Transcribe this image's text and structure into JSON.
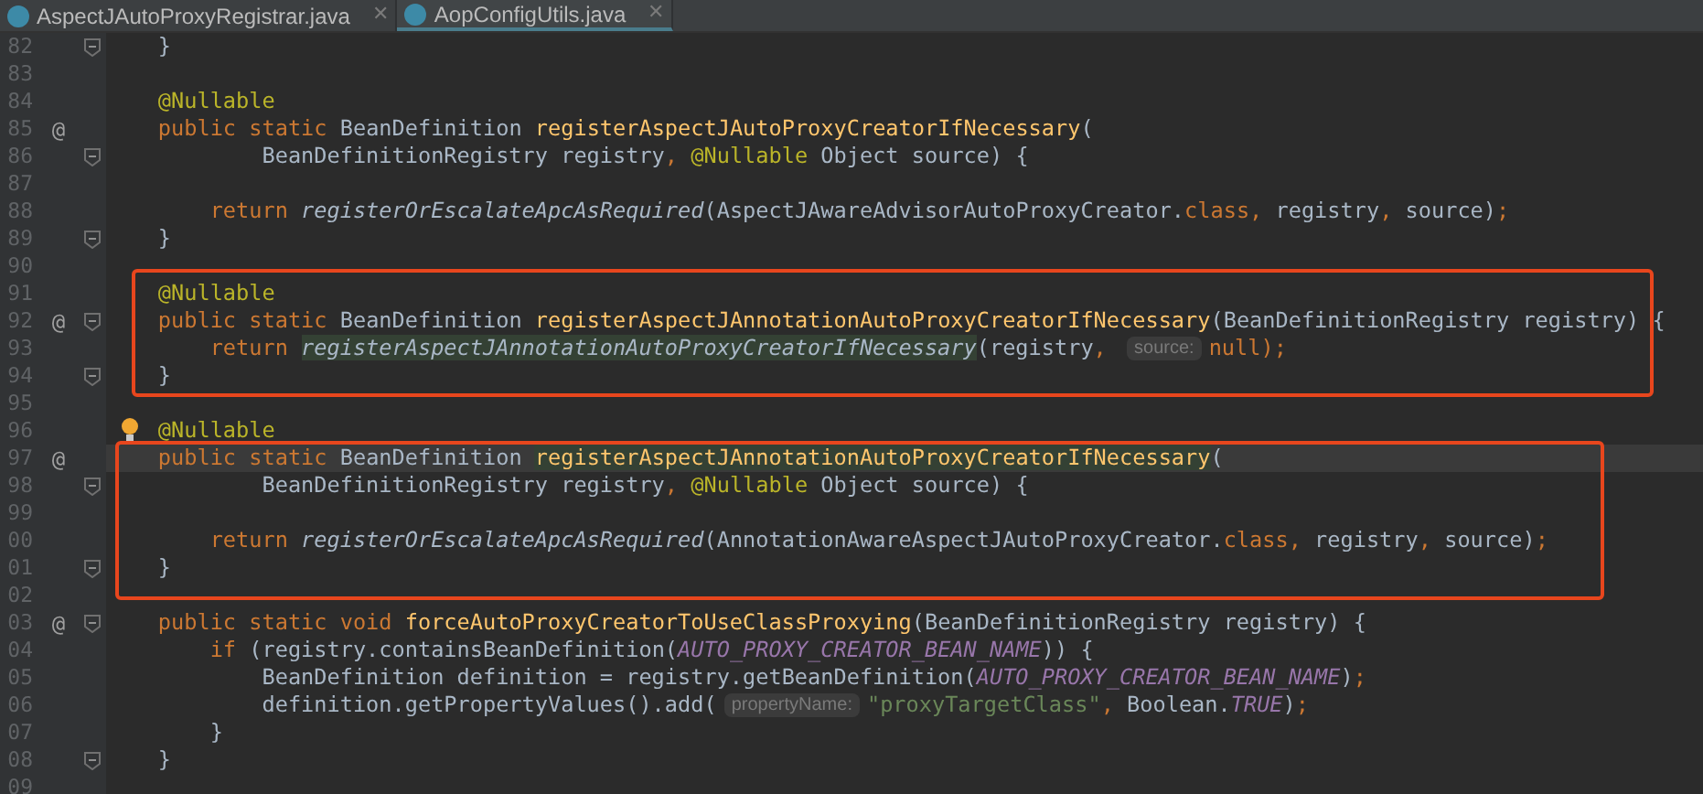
{
  "tabs": [
    {
      "label": "AspectJAutoProxyRegistrar.java",
      "selected": false,
      "close": "✕"
    },
    {
      "label": "AopConfigUtils.java",
      "selected": true,
      "close": "✕"
    }
  ],
  "lines": [
    {
      "number": "82",
      "fold": true,
      "tokens": [
        {
          "kind": "plain",
          "text": "    }"
        }
      ]
    },
    {
      "number": "83"
    },
    {
      "number": "84",
      "tokens": [
        {
          "kind": "annotation",
          "text": "    @Nullable"
        }
      ]
    },
    {
      "number": "85",
      "gutter_marker": "@",
      "tokens": [
        {
          "kind": "keyword",
          "text": "    public static "
        },
        {
          "kind": "plain",
          "text": "BeanDefinition "
        },
        {
          "kind": "method",
          "text": "registerAspectJAutoProxyCreatorIfNecessary"
        },
        {
          "kind": "plain",
          "text": "("
        }
      ]
    },
    {
      "number": "86",
      "fold": true,
      "tokens": [
        {
          "kind": "plain",
          "text": "            BeanDefinitionRegistry registry"
        },
        {
          "kind": "keyword",
          "text": ", "
        },
        {
          "kind": "annotation",
          "text": "@Nullable"
        },
        {
          "kind": "plain",
          "text": " Object source) {"
        }
      ]
    },
    {
      "number": "87"
    },
    {
      "number": "88",
      "tokens": [
        {
          "kind": "keyword",
          "text": "        return "
        },
        {
          "kind": "call",
          "text": "registerOrEscalateApcAsRequired"
        },
        {
          "kind": "plain",
          "text": "(AspectJAwareAdvisorAutoProxyCreator."
        },
        {
          "kind": "keyword",
          "text": "class, "
        },
        {
          "kind": "plain",
          "text": "registry"
        },
        {
          "kind": "keyword",
          "text": ", "
        },
        {
          "kind": "plain",
          "text": "source)"
        },
        {
          "kind": "keyword",
          "text": ";"
        }
      ]
    },
    {
      "number": "89",
      "fold": true,
      "tokens": [
        {
          "kind": "plain",
          "text": "    }"
        }
      ]
    },
    {
      "number": "90"
    },
    {
      "number": "91",
      "tokens": [
        {
          "kind": "annotation",
          "text": "    @Nullable"
        }
      ]
    },
    {
      "number": "92",
      "gutter_marker": "@",
      "fold": true,
      "tokens": [
        {
          "kind": "keyword",
          "text": "    public static "
        },
        {
          "kind": "plain",
          "text": "BeanDefinition "
        },
        {
          "kind": "method",
          "text": "registerAspectJAnnotationAutoProxyCreatorIfNecessary"
        },
        {
          "kind": "plain",
          "text": "(BeanDefinitionRegistry registry) {"
        }
      ]
    },
    {
      "number": "93",
      "tokens": [
        {
          "kind": "keyword",
          "text": "        return "
        },
        {
          "kind": "call-highlighted",
          "text": "registerAspectJAnnotationAutoProxyCreatorIfNecessary"
        },
        {
          "kind": "plain",
          "text": "(registry"
        },
        {
          "kind": "keyword",
          "text": ", "
        },
        {
          "kind": "hint",
          "text": "source:"
        },
        {
          "kind": "keyword",
          "text": "null);"
        }
      ]
    },
    {
      "number": "94",
      "fold": true,
      "tokens": [
        {
          "kind": "plain",
          "text": "    }"
        }
      ]
    },
    {
      "number": "95"
    },
    {
      "number": "96",
      "bulb": true,
      "tokens": [
        {
          "kind": "annotation",
          "text": "    @Nullable"
        }
      ]
    },
    {
      "number": "97",
      "gutter_marker": "@",
      "current": true,
      "tokens": [
        {
          "kind": "keyword",
          "text": "    public static "
        },
        {
          "kind": "plain",
          "text": "BeanDefinition "
        },
        {
          "kind": "method-highlighted",
          "text": "registerAspectJAnnotationAutoProxyCreatorIfNecessary"
        },
        {
          "kind": "plain",
          "text": "("
        }
      ]
    },
    {
      "number": "98",
      "fold": true,
      "tokens": [
        {
          "kind": "plain",
          "text": "            BeanDefinitionRegistry registry"
        },
        {
          "kind": "keyword",
          "text": ", "
        },
        {
          "kind": "annotation",
          "text": "@Nullable"
        },
        {
          "kind": "plain",
          "text": " Object source) {"
        }
      ]
    },
    {
      "number": "99"
    },
    {
      "number": "00",
      "tokens": [
        {
          "kind": "keyword",
          "text": "        return "
        },
        {
          "kind": "call",
          "text": "registerOrEscalateApcAsRequired"
        },
        {
          "kind": "plain",
          "text": "(AnnotationAwareAspectJAutoProxyCreator."
        },
        {
          "kind": "keyword",
          "text": "class, "
        },
        {
          "kind": "plain",
          "text": "registry"
        },
        {
          "kind": "keyword",
          "text": ", "
        },
        {
          "kind": "plain",
          "text": "source)"
        },
        {
          "kind": "keyword",
          "text": ";"
        }
      ]
    },
    {
      "number": "01",
      "fold": true,
      "tokens": [
        {
          "kind": "plain",
          "text": "    }"
        }
      ]
    },
    {
      "number": "02"
    },
    {
      "number": "03",
      "gutter_marker": "@",
      "fold": true,
      "tokens": [
        {
          "kind": "keyword",
          "text": "    public static void "
        },
        {
          "kind": "method",
          "text": "forceAutoProxyCreatorToUseClassProxying"
        },
        {
          "kind": "plain",
          "text": "(BeanDefinitionRegistry registry) {"
        }
      ]
    },
    {
      "number": "04",
      "tokens": [
        {
          "kind": "keyword",
          "text": "        if "
        },
        {
          "kind": "plain",
          "text": "(registry.containsBeanDefinition("
        },
        {
          "kind": "constant",
          "text": "AUTO_PROXY_CREATOR_BEAN_NAME"
        },
        {
          "kind": "plain",
          "text": ")) {"
        }
      ]
    },
    {
      "number": "05",
      "tokens": [
        {
          "kind": "plain",
          "text": "            BeanDefinition definition = registry.getBeanDefinition("
        },
        {
          "kind": "constant",
          "text": "AUTO_PROXY_CREATOR_BEAN_NAME"
        },
        {
          "kind": "plain",
          "text": ")"
        },
        {
          "kind": "keyword",
          "text": ";"
        }
      ]
    },
    {
      "number": "06",
      "tokens": [
        {
          "kind": "plain",
          "text": "            definition.getPropertyValues().add("
        },
        {
          "kind": "hint",
          "text": "propertyName:"
        },
        {
          "kind": "string",
          "text": "\"proxyTargetClass\""
        },
        {
          "kind": "keyword",
          "text": ", "
        },
        {
          "kind": "plain",
          "text": "Boolean."
        },
        {
          "kind": "constant",
          "text": "TRUE"
        },
        {
          "kind": "plain",
          "text": ")"
        },
        {
          "kind": "keyword",
          "text": ";"
        }
      ]
    },
    {
      "number": "07",
      "tokens": [
        {
          "kind": "plain",
          "text": "        }"
        }
      ]
    },
    {
      "number": "08",
      "fold": true,
      "tokens": [
        {
          "kind": "plain",
          "text": "    }"
        }
      ]
    },
    {
      "number": "09"
    }
  ]
}
